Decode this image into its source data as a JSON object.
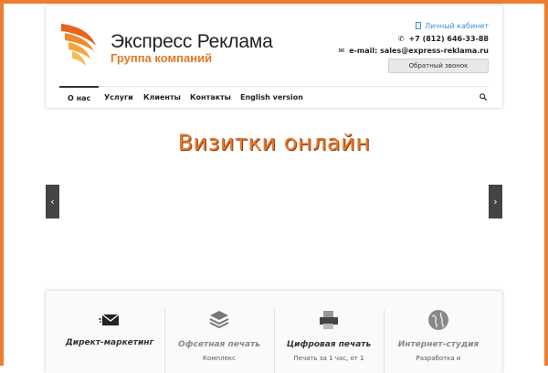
{
  "header": {
    "brand_name": "Экспресс Реклама",
    "brand_sub": "Группа компаний",
    "cabinet_label": "Личный кабинет",
    "phone": "+7 (812) 646-33-88",
    "email": "e-mail: sales@express-reklama.ru",
    "callback_label": "Обратный звонок"
  },
  "nav": {
    "items": [
      {
        "label": "О нас"
      },
      {
        "label": "Услуги"
      },
      {
        "label": "Клиенты"
      },
      {
        "label": "Контакты"
      },
      {
        "label": "English version"
      }
    ]
  },
  "slider": {
    "title": "Визитки онлайн",
    "prev": "‹",
    "next": "›"
  },
  "services": [
    {
      "name": "Директ-маркетинг",
      "desc": "",
      "icon": "envelope-icon"
    },
    {
      "name": "Офсетная печать",
      "desc": "Комплекс",
      "icon": "layers-icon"
    },
    {
      "name": "Цифровая печать",
      "desc": "Печать за 1 час, от 1",
      "icon": "printer-icon"
    },
    {
      "name": "Интернет-студия",
      "desc": "Разработка и",
      "icon": "globe-icon"
    }
  ],
  "colors": {
    "accent": "#ee7d2f",
    "link": "#3a8fd8"
  }
}
